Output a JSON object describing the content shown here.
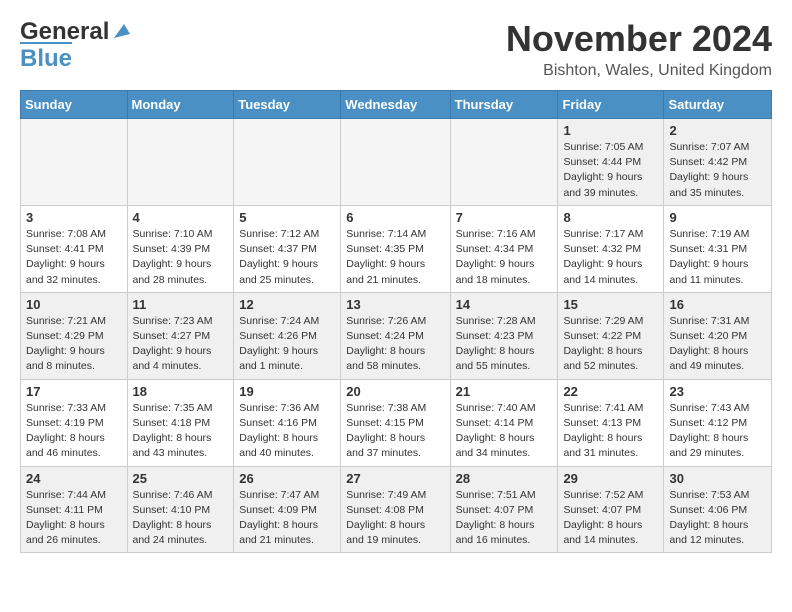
{
  "header": {
    "logo_general": "General",
    "logo_blue": "Blue",
    "month_title": "November 2024",
    "location": "Bishton, Wales, United Kingdom"
  },
  "days_of_week": [
    "Sunday",
    "Monday",
    "Tuesday",
    "Wednesday",
    "Thursday",
    "Friday",
    "Saturday"
  ],
  "weeks": [
    [
      {
        "day": "",
        "info": "",
        "empty": true
      },
      {
        "day": "",
        "info": "",
        "empty": true
      },
      {
        "day": "",
        "info": "",
        "empty": true
      },
      {
        "day": "",
        "info": "",
        "empty": true
      },
      {
        "day": "",
        "info": "",
        "empty": true
      },
      {
        "day": "1",
        "info": "Sunrise: 7:05 AM\nSunset: 4:44 PM\nDaylight: 9 hours\nand 39 minutes."
      },
      {
        "day": "2",
        "info": "Sunrise: 7:07 AM\nSunset: 4:42 PM\nDaylight: 9 hours\nand 35 minutes."
      }
    ],
    [
      {
        "day": "3",
        "info": "Sunrise: 7:08 AM\nSunset: 4:41 PM\nDaylight: 9 hours\nand 32 minutes."
      },
      {
        "day": "4",
        "info": "Sunrise: 7:10 AM\nSunset: 4:39 PM\nDaylight: 9 hours\nand 28 minutes."
      },
      {
        "day": "5",
        "info": "Sunrise: 7:12 AM\nSunset: 4:37 PM\nDaylight: 9 hours\nand 25 minutes."
      },
      {
        "day": "6",
        "info": "Sunrise: 7:14 AM\nSunset: 4:35 PM\nDaylight: 9 hours\nand 21 minutes."
      },
      {
        "day": "7",
        "info": "Sunrise: 7:16 AM\nSunset: 4:34 PM\nDaylight: 9 hours\nand 18 minutes."
      },
      {
        "day": "8",
        "info": "Sunrise: 7:17 AM\nSunset: 4:32 PM\nDaylight: 9 hours\nand 14 minutes."
      },
      {
        "day": "9",
        "info": "Sunrise: 7:19 AM\nSunset: 4:31 PM\nDaylight: 9 hours\nand 11 minutes."
      }
    ],
    [
      {
        "day": "10",
        "info": "Sunrise: 7:21 AM\nSunset: 4:29 PM\nDaylight: 9 hours\nand 8 minutes."
      },
      {
        "day": "11",
        "info": "Sunrise: 7:23 AM\nSunset: 4:27 PM\nDaylight: 9 hours\nand 4 minutes."
      },
      {
        "day": "12",
        "info": "Sunrise: 7:24 AM\nSunset: 4:26 PM\nDaylight: 9 hours\nand 1 minute."
      },
      {
        "day": "13",
        "info": "Sunrise: 7:26 AM\nSunset: 4:24 PM\nDaylight: 8 hours\nand 58 minutes."
      },
      {
        "day": "14",
        "info": "Sunrise: 7:28 AM\nSunset: 4:23 PM\nDaylight: 8 hours\nand 55 minutes."
      },
      {
        "day": "15",
        "info": "Sunrise: 7:29 AM\nSunset: 4:22 PM\nDaylight: 8 hours\nand 52 minutes."
      },
      {
        "day": "16",
        "info": "Sunrise: 7:31 AM\nSunset: 4:20 PM\nDaylight: 8 hours\nand 49 minutes."
      }
    ],
    [
      {
        "day": "17",
        "info": "Sunrise: 7:33 AM\nSunset: 4:19 PM\nDaylight: 8 hours\nand 46 minutes."
      },
      {
        "day": "18",
        "info": "Sunrise: 7:35 AM\nSunset: 4:18 PM\nDaylight: 8 hours\nand 43 minutes."
      },
      {
        "day": "19",
        "info": "Sunrise: 7:36 AM\nSunset: 4:16 PM\nDaylight: 8 hours\nand 40 minutes."
      },
      {
        "day": "20",
        "info": "Sunrise: 7:38 AM\nSunset: 4:15 PM\nDaylight: 8 hours\nand 37 minutes."
      },
      {
        "day": "21",
        "info": "Sunrise: 7:40 AM\nSunset: 4:14 PM\nDaylight: 8 hours\nand 34 minutes."
      },
      {
        "day": "22",
        "info": "Sunrise: 7:41 AM\nSunset: 4:13 PM\nDaylight: 8 hours\nand 31 minutes."
      },
      {
        "day": "23",
        "info": "Sunrise: 7:43 AM\nSunset: 4:12 PM\nDaylight: 8 hours\nand 29 minutes."
      }
    ],
    [
      {
        "day": "24",
        "info": "Sunrise: 7:44 AM\nSunset: 4:11 PM\nDaylight: 8 hours\nand 26 minutes."
      },
      {
        "day": "25",
        "info": "Sunrise: 7:46 AM\nSunset: 4:10 PM\nDaylight: 8 hours\nand 24 minutes."
      },
      {
        "day": "26",
        "info": "Sunrise: 7:47 AM\nSunset: 4:09 PM\nDaylight: 8 hours\nand 21 minutes."
      },
      {
        "day": "27",
        "info": "Sunrise: 7:49 AM\nSunset: 4:08 PM\nDaylight: 8 hours\nand 19 minutes."
      },
      {
        "day": "28",
        "info": "Sunrise: 7:51 AM\nSunset: 4:07 PM\nDaylight: 8 hours\nand 16 minutes."
      },
      {
        "day": "29",
        "info": "Sunrise: 7:52 AM\nSunset: 4:07 PM\nDaylight: 8 hours\nand 14 minutes."
      },
      {
        "day": "30",
        "info": "Sunrise: 7:53 AM\nSunset: 4:06 PM\nDaylight: 8 hours\nand 12 minutes."
      }
    ]
  ]
}
